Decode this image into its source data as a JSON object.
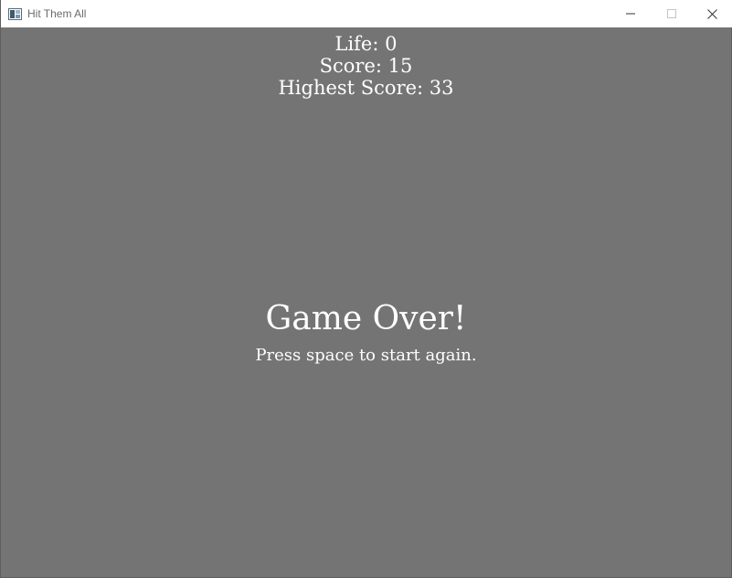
{
  "window": {
    "title": "Hit Them All",
    "icon": "app-window-icon"
  },
  "hud": {
    "life": "Life: 0",
    "score": "Score: 15",
    "highest_score": "Highest Score: 33"
  },
  "game_over": {
    "title": "Game Over!",
    "subtitle": "Press space to start again."
  },
  "colors": {
    "background": "#747474",
    "text": "#ffffff",
    "titlebar": "#ffffff"
  }
}
